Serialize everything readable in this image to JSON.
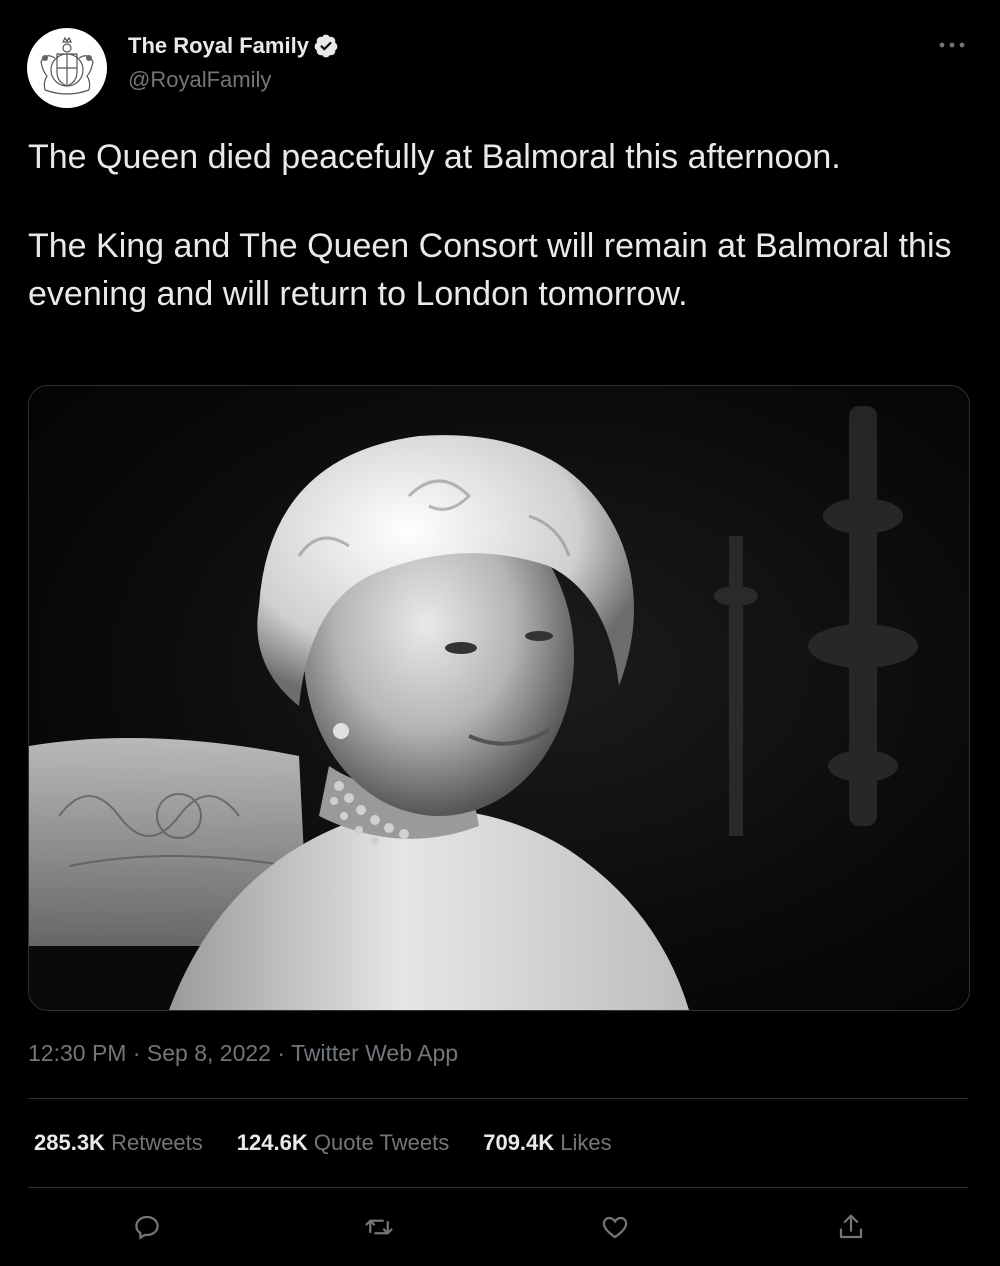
{
  "author": {
    "display_name": "The Royal Family",
    "handle": "@RoyalFamily",
    "verified_icon": "verified-badge-icon",
    "avatar_icon": "royal-coat-of-arms-icon"
  },
  "more_icon": "more-options-icon",
  "tweet": {
    "paragraphs": [
      "The Queen died peacefully at Balmoral this afternoon.",
      "The King and The Queen Consort will remain at Balmoral this evening and will return to London tomorrow."
    ],
    "media": "black-and-white-portrait-photo"
  },
  "meta": {
    "time": "12:30 PM",
    "date": "Sep 8, 2022",
    "source": "Twitter Web App",
    "separator": " · "
  },
  "stats": {
    "retweets_count": "285.3K",
    "retweets_label": "Retweets",
    "quotes_count": "124.6K",
    "quotes_label": "Quote Tweets",
    "likes_count": "709.4K",
    "likes_label": "Likes"
  },
  "actions": [
    "reply-icon",
    "retweet-icon",
    "like-icon",
    "share-icon"
  ],
  "colors": {
    "background": "#000000",
    "text": "#e7e9ea",
    "muted": "#71767b",
    "divider": "#2f3336"
  }
}
